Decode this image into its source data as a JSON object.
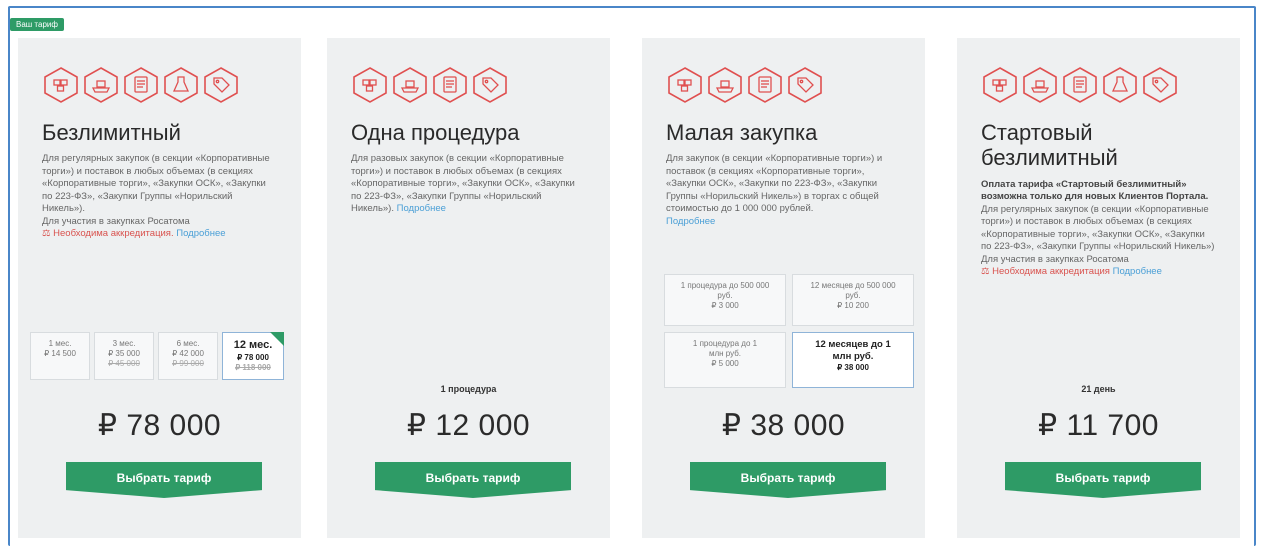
{
  "badge": "Ваш тариф",
  "currency": "₽",
  "colors": {
    "accent": "#2e9b66",
    "icon": "#e05050",
    "link": "#4a9fd6",
    "frame": "#4a86c8"
  },
  "icon_names": [
    "boxes-icon",
    "ship-icon",
    "document-icon",
    "flask-icon",
    "tag-icon"
  ],
  "cards": [
    {
      "title": "Безлимитный",
      "desc": "Для регулярных закупок (в секции «Корпоративные торги») и поставок в любых объемах (в секциях «Корпоративные торги», «Закупки ОСК», «Закупки по 223-ФЗ», «Закупки Группы «Норильский Никель»).",
      "desc2": "Для участия в закупках Росатома",
      "warn": "Необходима аккредитация.",
      "more": "Подробнее",
      "options": [
        {
          "label": "1 мес.",
          "price": "₽ 14 500",
          "old": ""
        },
        {
          "label": "3 мес.",
          "price": "₽ 35 000",
          "old": "₽ 45 000"
        },
        {
          "label": "6 мес.",
          "price": "₽ 42 000",
          "old": "₽ 99 000"
        },
        {
          "label": "12 мес.",
          "price": "₽ 78 000",
          "old": "₽ 118 000"
        }
      ],
      "selected_option": 3,
      "price": "₽ 78 000",
      "button": "Выбрать тариф"
    },
    {
      "title": "Одна процедура",
      "desc": "Для разовых закупок (в секции «Корпоративные торги») и поставок в любых объемах (в секциях «Корпоративные торги», «Закупки ОСК», «Закупки по 223-ФЗ», «Закупки Группы «Норильский Никель»).",
      "more": "Подробнее",
      "unit": "1 процедура",
      "price": "₽ 12 000",
      "button": "Выбрать тариф"
    },
    {
      "title": "Малая закупка",
      "desc": "Для закупок (в секции «Корпоративные торги») и поставок (в секциях «Корпоративные торги», «Закупки ОСК», «Закупки по 223-ФЗ», «Закупки Группы «Норильский Никель») в торгах с общей стоимостью до 1 000 000 рублей.",
      "more": "Подробнее",
      "options": [
        {
          "label": "1 процедура до 500 000 руб.",
          "price": "₽ 3 000"
        },
        {
          "label": "12 месяцев до 500 000 руб.",
          "price": "₽ 10 200"
        },
        {
          "label": "1 процедура до 1 млн руб.",
          "price": "₽ 5 000"
        },
        {
          "label": "12 месяцев до 1 млн руб.",
          "price": "₽ 38 000"
        }
      ],
      "selected_option": 3,
      "price": "₽ 38 000",
      "button": "Выбрать тариф"
    },
    {
      "title": "Стартовый безлимитный",
      "bold": "Оплата тарифа «Стартовый безлимитный» возможна только для новых Клиентов Портала.",
      "desc": "Для регулярных закупок (в секции «Корпоративные торги») и поставок в любых объемах (в секциях «Корпоративные торги», «Закупки ОСК», «Закупки по 223-ФЗ», «Закупки Группы «Норильский Никель»)",
      "desc2": "Для участия в закупках Росатома",
      "warn": "Необходима аккредитация",
      "more": "Подробнее",
      "unit": "21 день",
      "price": "₽ 11 700",
      "button": "Выбрать тариф"
    }
  ]
}
